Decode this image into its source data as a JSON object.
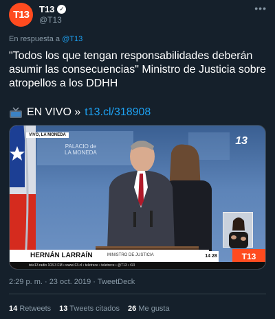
{
  "author": {
    "avatar_text": "T13",
    "display_name": "T13",
    "handle": "@T13",
    "verified_icon": "✓"
  },
  "reply": {
    "prefix": "En respuesta a",
    "mention": "@T13"
  },
  "tweet": {
    "text": "\"Todos los que tengan responsabilidades deberán asumir las consecuencias\" Ministro de Justicia sobre atropellos a los DDHH",
    "live_label": "EN VIVO »",
    "link": "t13.cl/318908"
  },
  "media": {
    "live_badge": "VIVO, LA MONEDA",
    "palace_label": "PALACIO de\nLA MONEDA",
    "watermark": "13",
    "lower_third_name": "HERNÁN LARRAÍN",
    "lower_third_role": "MINISTRO DE JUSTICIA",
    "ticker": "tele13 radio 103.3 FM  •  www.t13.cl  •  teletrece  •  teletrece  •  @T13  •  t13",
    "clock": "14 28",
    "channel_box": "T13"
  },
  "meta": {
    "timestamp": "2:29 p. m. · 23 oct. 2019 · TweetDeck",
    "retweets_count": "14",
    "retweets_label": "Retweets",
    "quotes_count": "13",
    "quotes_label": "Tweets citados",
    "likes_count": "26",
    "likes_label": "Me gusta"
  },
  "colors": {
    "background": "#15202b",
    "secondary_text": "#8899a6",
    "link": "#1da1f2",
    "brand": "#ff4b1f"
  },
  "icons": {
    "more": "more-icon",
    "tv": "tv-icon",
    "verified": "verified-icon"
  }
}
